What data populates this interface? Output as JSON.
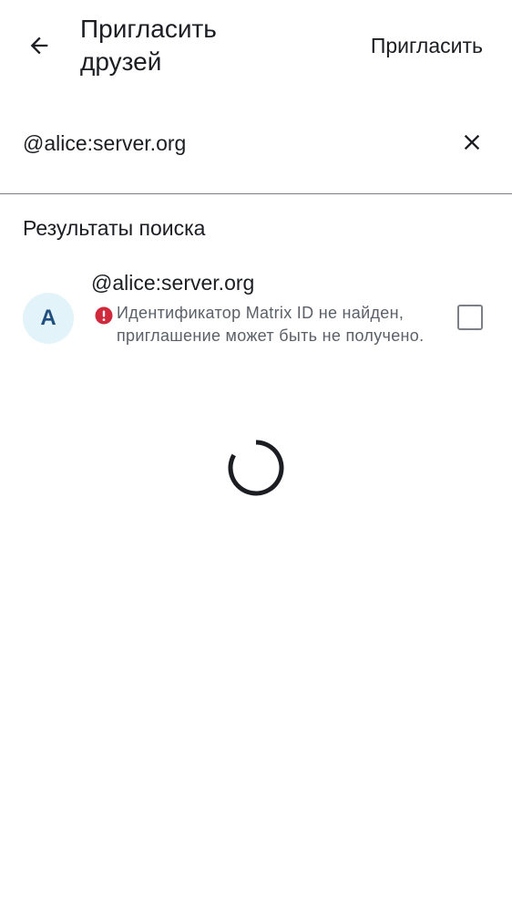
{
  "app_bar": {
    "title": "Пригласить друзей",
    "back_icon": "arrow-left-icon",
    "action_label": "Пригласить"
  },
  "search": {
    "value": "@alice:server.org",
    "clear_icon": "close-icon"
  },
  "results": {
    "section_title": "Результаты поиска",
    "items": [
      {
        "avatar_letter": "A",
        "name": "@alice:server.org",
        "warning_icon": "error-icon",
        "warning": "Идентификатор Matrix ID не найден, приглашение может быть не получено.",
        "checked": false
      }
    ]
  },
  "status": {
    "loading": true
  },
  "colors": {
    "text_primary": "#1b1d22",
    "text_secondary": "#5b6068",
    "error": "#d1293c",
    "avatar_bg": "#e3f3fa",
    "avatar_fg": "#1f4f7e",
    "divider": "#7d7f86"
  }
}
